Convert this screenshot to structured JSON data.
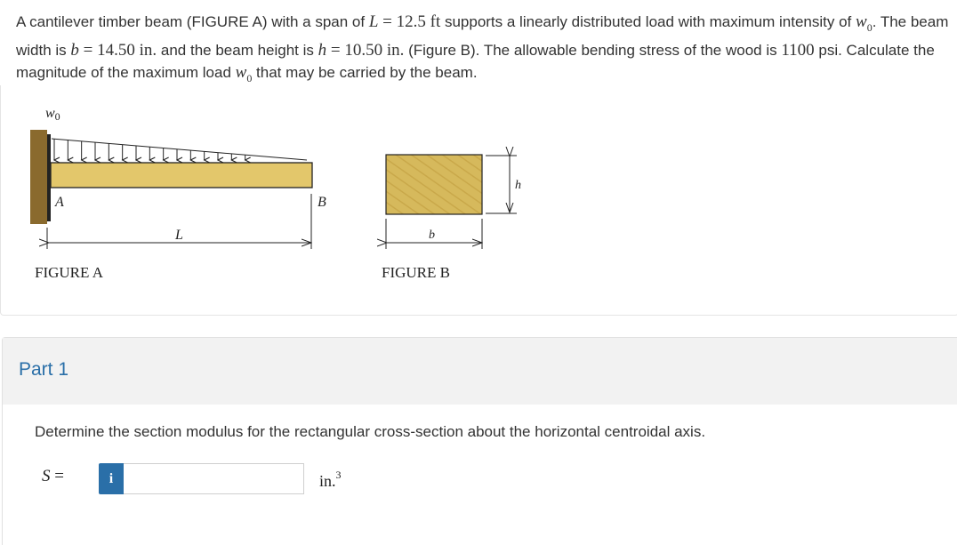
{
  "problem": {
    "t1": "A cantilever timber beam (FIGURE A) with a span of ",
    "L_sym": "L",
    "eq1": " = 12.5 ft",
    "t2": " supports a linearly distributed load with maximum intensity of ",
    "w0_sym": "w",
    "w0_sub": "0",
    "t3": ". The beam width is ",
    "b_sym": "b",
    "eq2": " = 14.50 in.",
    "t4": " and the beam height is ",
    "h_sym": "h",
    "eq3": " = 10.50 in.",
    "t5": " (Figure B). The allowable bending stress of the wood is ",
    "stress_val": "1100",
    "t6": " psi. Calculate the magnitude of the maximum load ",
    "t7": " that may be carried by the beam."
  },
  "figure_a": {
    "caption": "FIGURE A",
    "load_label": "w0",
    "point_a": "A",
    "point_b": "B",
    "span_label": "L"
  },
  "figure_b": {
    "caption": "FIGURE B",
    "width_label": "b",
    "height_label": "h"
  },
  "part": {
    "title": "Part 1",
    "question": "Determine the section modulus for the rectangular cross-section about the horizontal centroidal axis.",
    "var_label": "S",
    "equals": "=",
    "info_icon": "i",
    "input_value": "",
    "unit": "in.",
    "unit_exp": "3"
  },
  "colors": {
    "accent": "#2a6fa8",
    "beam": "#e3c76b",
    "wall": "#8a6a2e"
  }
}
